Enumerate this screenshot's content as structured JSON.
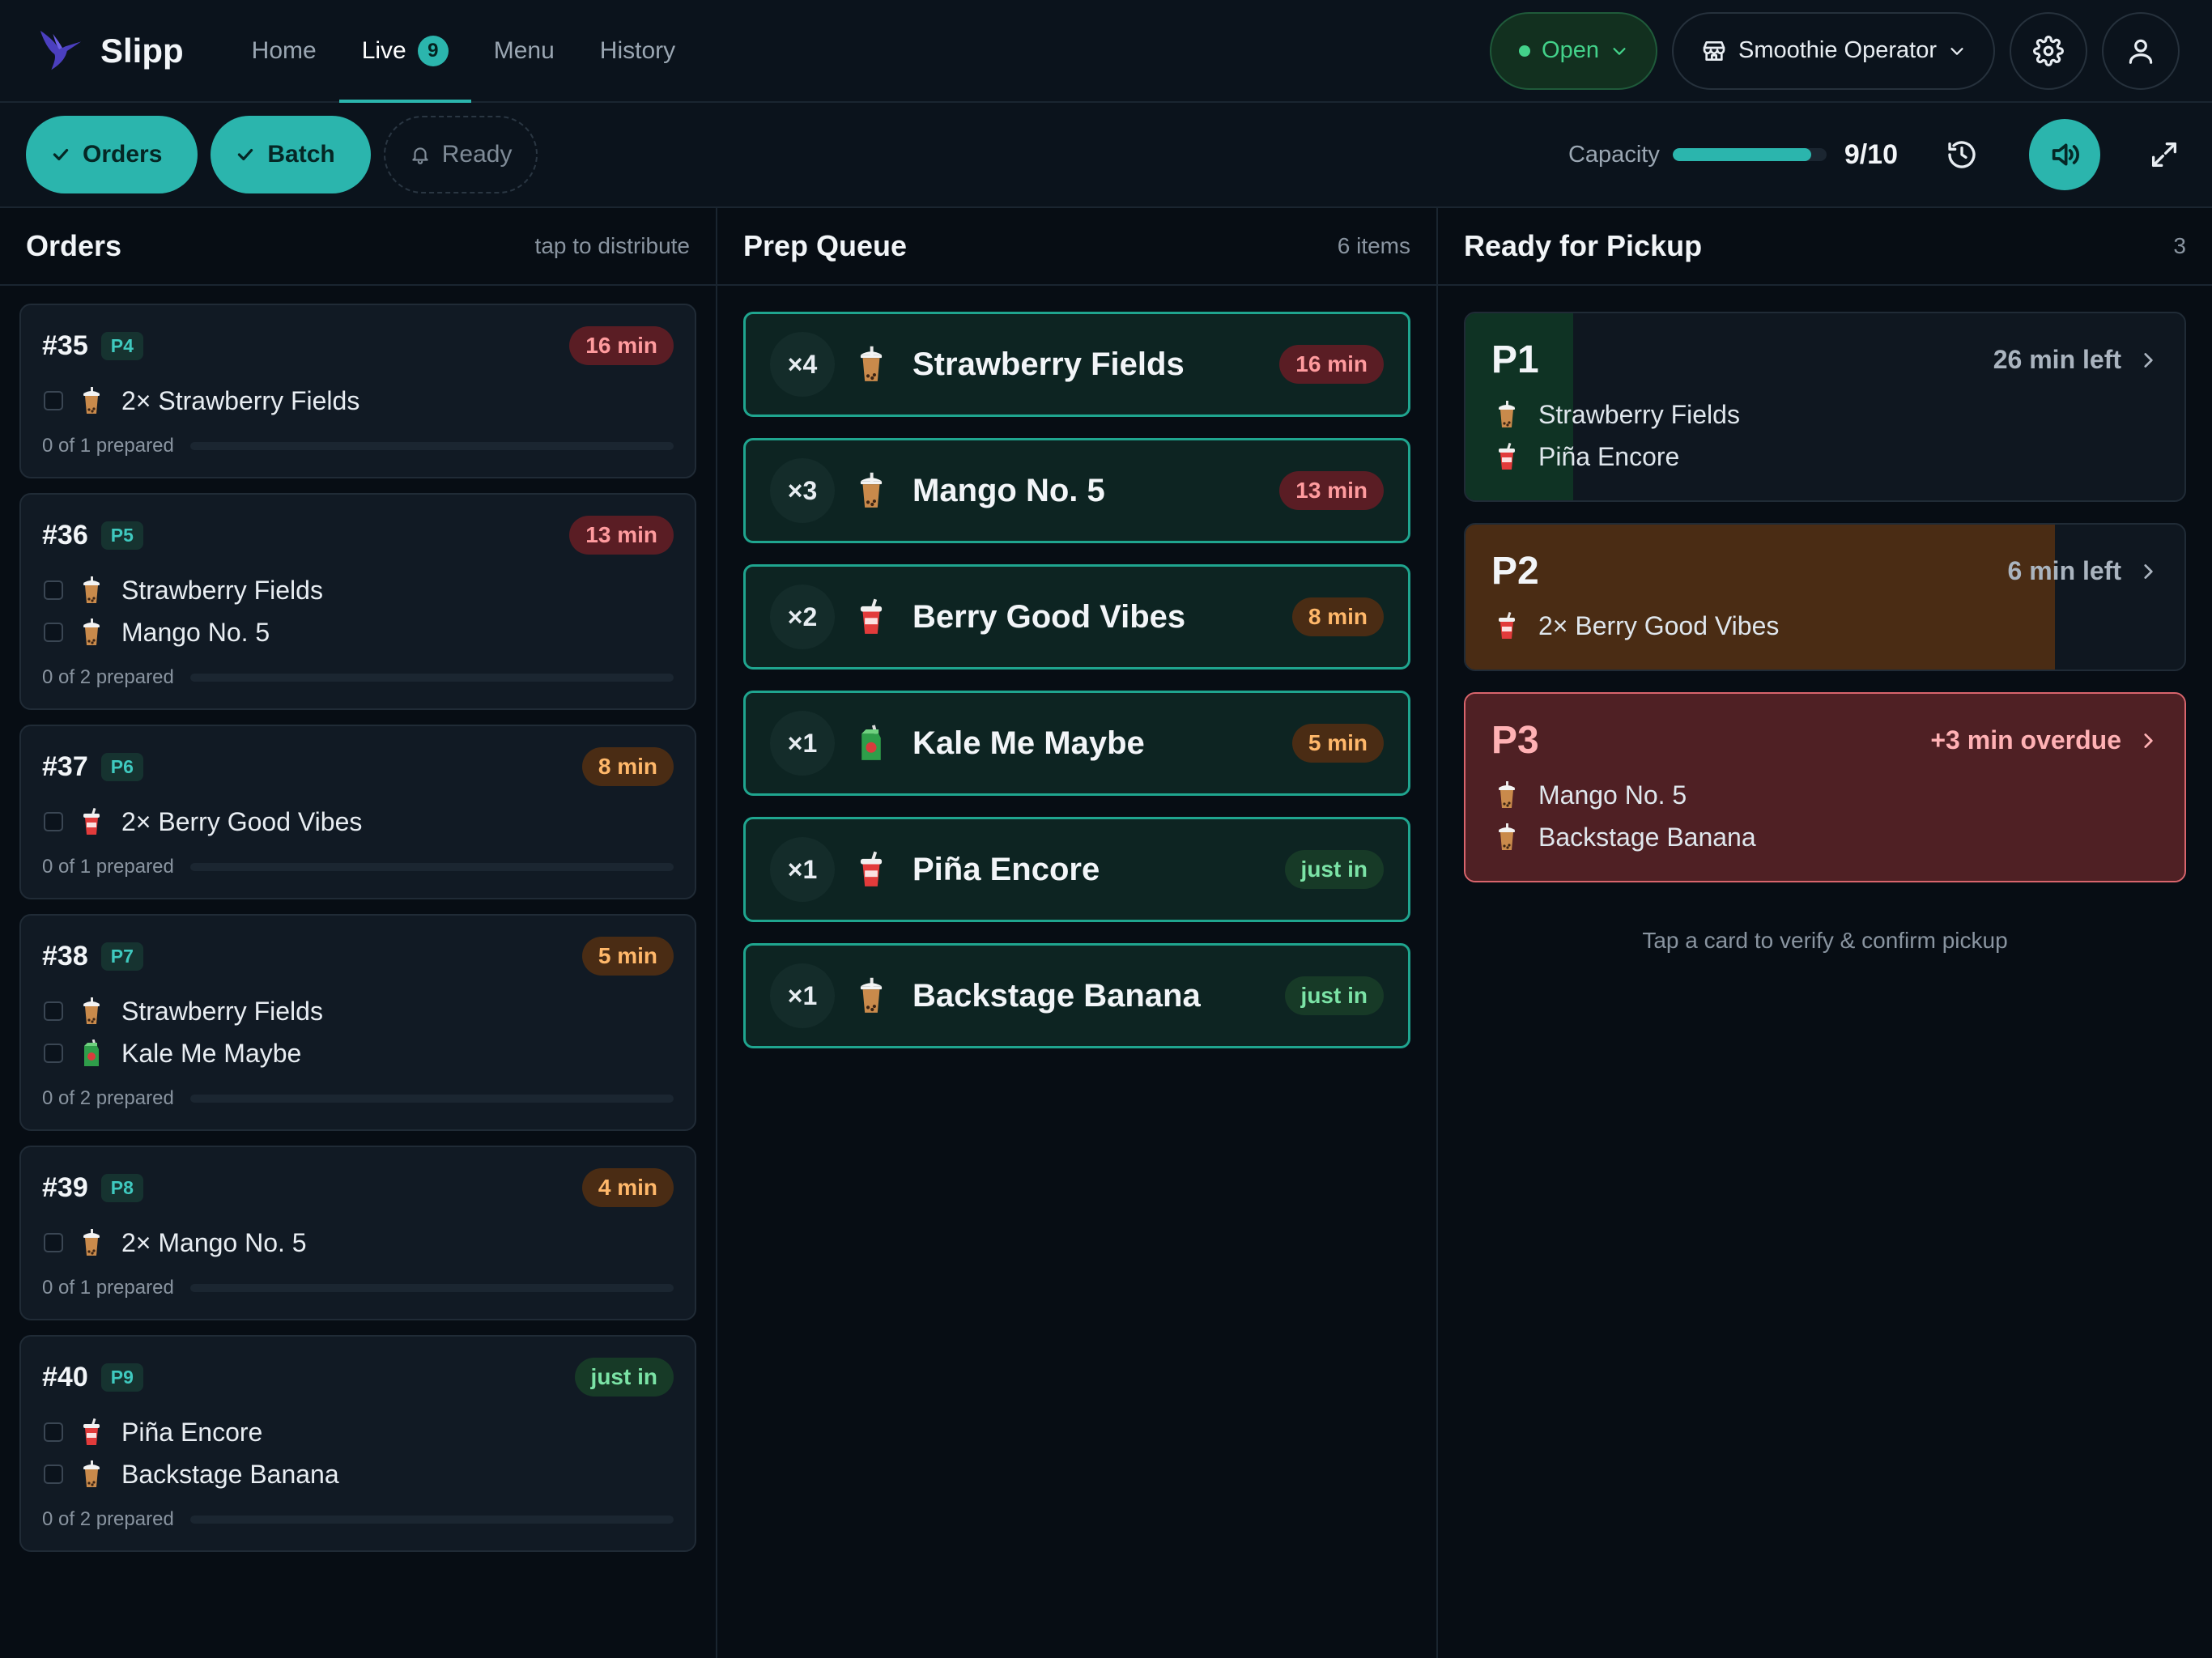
{
  "app": {
    "name": "Slipp"
  },
  "nav": {
    "home": "Home",
    "live": "Live",
    "live_badge": "9",
    "menu": "Menu",
    "history": "History"
  },
  "header": {
    "status_label": "Open",
    "store_name": "Smoothie Operator"
  },
  "filters": {
    "orders": "Orders",
    "batch": "Batch",
    "ready": "Ready"
  },
  "capacity": {
    "label": "Capacity",
    "value": "9/10",
    "level": 0.9
  },
  "colors": {
    "accent": "#2bb5ad",
    "open": "#43d28a",
    "overdue": "#d9656d",
    "warn": "#ffb86a"
  },
  "orders_col": {
    "title": "Orders",
    "hint": "tap to distribute",
    "cards": [
      {
        "number": "#35",
        "pager": "P4",
        "age": "16 min",
        "tone": "red",
        "items": [
          {
            "text": "2× Strawberry Fields",
            "icon": "bubble-tea-icon"
          }
        ],
        "progress": "0 of 1 prepared",
        "progress_value": 0
      },
      {
        "number": "#36",
        "pager": "P5",
        "age": "13 min",
        "tone": "red",
        "items": [
          {
            "text": "Strawberry Fields",
            "icon": "bubble-tea-icon"
          },
          {
            "text": "Mango No. 5",
            "icon": "bubble-tea-icon"
          }
        ],
        "progress": "0 of 2 prepared",
        "progress_value": 0
      },
      {
        "number": "#37",
        "pager": "P6",
        "age": "8 min",
        "tone": "orange",
        "items": [
          {
            "text": "2× Berry Good Vibes",
            "icon": "cup-straw-icon"
          }
        ],
        "progress": "0 of 1 prepared",
        "progress_value": 0
      },
      {
        "number": "#38",
        "pager": "P7",
        "age": "5 min",
        "tone": "orange",
        "items": [
          {
            "text": "Strawberry Fields",
            "icon": "bubble-tea-icon"
          },
          {
            "text": "Kale Me Maybe",
            "icon": "juice-box-icon"
          }
        ],
        "progress": "0 of 2 prepared",
        "progress_value": 0
      },
      {
        "number": "#39",
        "pager": "P8",
        "age": "4 min",
        "tone": "orange",
        "items": [
          {
            "text": "2× Mango No. 5",
            "icon": "bubble-tea-icon"
          }
        ],
        "progress": "0 of 1 prepared",
        "progress_value": 0
      },
      {
        "number": "#40",
        "pager": "P9",
        "age": "just in",
        "tone": "green",
        "items": [
          {
            "text": "Piña Encore",
            "icon": "cup-straw-icon"
          },
          {
            "text": "Backstage Banana",
            "icon": "bubble-tea-icon"
          }
        ],
        "progress": "0 of 2 prepared",
        "progress_value": 0
      }
    ]
  },
  "prep_col": {
    "title": "Prep Queue",
    "count": "6 items",
    "items": [
      {
        "qty": "×4",
        "name": "Strawberry Fields",
        "age": "16 min",
        "tone": "red",
        "icon": "bubble-tea-icon"
      },
      {
        "qty": "×3",
        "name": "Mango No. 5",
        "age": "13 min",
        "tone": "red",
        "icon": "bubble-tea-icon"
      },
      {
        "qty": "×2",
        "name": "Berry Good Vibes",
        "age": "8 min",
        "tone": "orange",
        "icon": "cup-straw-icon"
      },
      {
        "qty": "×1",
        "name": "Kale Me Maybe",
        "age": "5 min",
        "tone": "orange",
        "icon": "juice-box-icon"
      },
      {
        "qty": "×1",
        "name": "Piña Encore",
        "age": "just in",
        "tone": "green",
        "icon": "cup-straw-icon"
      },
      {
        "qty": "×1",
        "name": "Backstage Banana",
        "age": "just in",
        "tone": "green",
        "icon": "bubble-tea-icon"
      }
    ]
  },
  "ready_col": {
    "title": "Ready for Pickup",
    "count": "3",
    "cards": [
      {
        "code": "P1",
        "time": "26 min left",
        "state": "ok",
        "elapsed": 0.15,
        "fill_color": "#0f3324",
        "items": [
          {
            "text": "Strawberry Fields",
            "icon": "bubble-tea-icon"
          },
          {
            "text": "Piña Encore",
            "icon": "cup-straw-icon"
          }
        ]
      },
      {
        "code": "P2",
        "time": "6 min left",
        "state": "warn",
        "elapsed": 0.82,
        "fill_color": "#4a2c14",
        "items": [
          {
            "text": "2× Berry Good Vibes",
            "icon": "cup-straw-icon"
          }
        ]
      },
      {
        "code": "P3",
        "time": "+3 min overdue",
        "state": "overdue",
        "elapsed": 1,
        "fill_color": "#4f2024",
        "items": [
          {
            "text": "Mango No. 5",
            "icon": "bubble-tea-icon"
          },
          {
            "text": "Backstage Banana",
            "icon": "bubble-tea-icon"
          }
        ]
      }
    ],
    "hint": "Tap a card to verify & confirm pickup"
  }
}
